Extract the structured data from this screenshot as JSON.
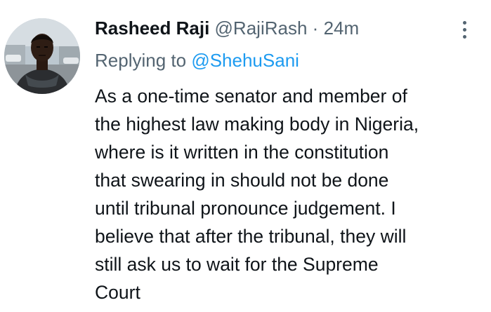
{
  "tweet": {
    "display_name": "Rasheed Raji",
    "handle": "@RajiRash",
    "separator": "·",
    "timestamp": "24m",
    "replying_prefix": "Replying to",
    "replying_to": "@ShehuSani",
    "text_lines": [
      "As a one-time senator and member of",
      "the highest law making body in Nigeria,",
      "where is it written in the constitution",
      "that swearing in should not be done",
      "until tribunal pronounce judgement. I",
      "believe that after the tribunal, they will",
      "still ask us to wait for the Supreme",
      "Court"
    ],
    "more_icon": "vertical-ellipsis-icon"
  },
  "colors": {
    "text_primary": "#0f1419",
    "text_secondary": "#536471",
    "link": "#1d9bf0"
  }
}
